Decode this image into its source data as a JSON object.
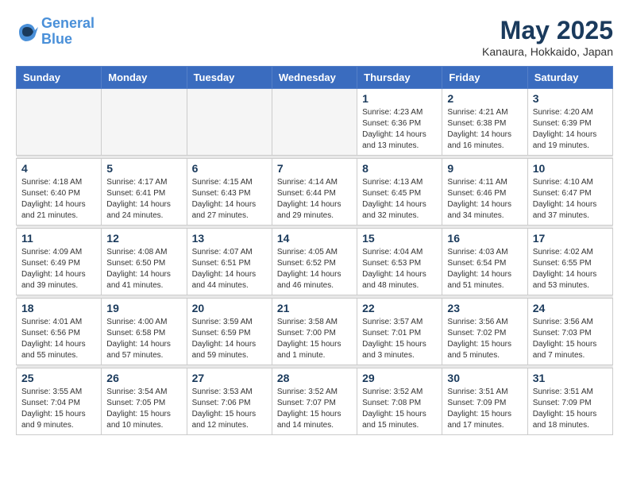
{
  "logo": {
    "line1": "General",
    "line2": "Blue"
  },
  "title": "May 2025",
  "subtitle": "Kanaura, Hokkaido, Japan",
  "days_of_week": [
    "Sunday",
    "Monday",
    "Tuesday",
    "Wednesday",
    "Thursday",
    "Friday",
    "Saturday"
  ],
  "weeks": [
    [
      {
        "day": "",
        "info": ""
      },
      {
        "day": "",
        "info": ""
      },
      {
        "day": "",
        "info": ""
      },
      {
        "day": "",
        "info": ""
      },
      {
        "day": "1",
        "info": "Sunrise: 4:23 AM\nSunset: 6:36 PM\nDaylight: 14 hours\nand 13 minutes."
      },
      {
        "day": "2",
        "info": "Sunrise: 4:21 AM\nSunset: 6:38 PM\nDaylight: 14 hours\nand 16 minutes."
      },
      {
        "day": "3",
        "info": "Sunrise: 4:20 AM\nSunset: 6:39 PM\nDaylight: 14 hours\nand 19 minutes."
      }
    ],
    [
      {
        "day": "4",
        "info": "Sunrise: 4:18 AM\nSunset: 6:40 PM\nDaylight: 14 hours\nand 21 minutes."
      },
      {
        "day": "5",
        "info": "Sunrise: 4:17 AM\nSunset: 6:41 PM\nDaylight: 14 hours\nand 24 minutes."
      },
      {
        "day": "6",
        "info": "Sunrise: 4:15 AM\nSunset: 6:43 PM\nDaylight: 14 hours\nand 27 minutes."
      },
      {
        "day": "7",
        "info": "Sunrise: 4:14 AM\nSunset: 6:44 PM\nDaylight: 14 hours\nand 29 minutes."
      },
      {
        "day": "8",
        "info": "Sunrise: 4:13 AM\nSunset: 6:45 PM\nDaylight: 14 hours\nand 32 minutes."
      },
      {
        "day": "9",
        "info": "Sunrise: 4:11 AM\nSunset: 6:46 PM\nDaylight: 14 hours\nand 34 minutes."
      },
      {
        "day": "10",
        "info": "Sunrise: 4:10 AM\nSunset: 6:47 PM\nDaylight: 14 hours\nand 37 minutes."
      }
    ],
    [
      {
        "day": "11",
        "info": "Sunrise: 4:09 AM\nSunset: 6:49 PM\nDaylight: 14 hours\nand 39 minutes."
      },
      {
        "day": "12",
        "info": "Sunrise: 4:08 AM\nSunset: 6:50 PM\nDaylight: 14 hours\nand 41 minutes."
      },
      {
        "day": "13",
        "info": "Sunrise: 4:07 AM\nSunset: 6:51 PM\nDaylight: 14 hours\nand 44 minutes."
      },
      {
        "day": "14",
        "info": "Sunrise: 4:05 AM\nSunset: 6:52 PM\nDaylight: 14 hours\nand 46 minutes."
      },
      {
        "day": "15",
        "info": "Sunrise: 4:04 AM\nSunset: 6:53 PM\nDaylight: 14 hours\nand 48 minutes."
      },
      {
        "day": "16",
        "info": "Sunrise: 4:03 AM\nSunset: 6:54 PM\nDaylight: 14 hours\nand 51 minutes."
      },
      {
        "day": "17",
        "info": "Sunrise: 4:02 AM\nSunset: 6:55 PM\nDaylight: 14 hours\nand 53 minutes."
      }
    ],
    [
      {
        "day": "18",
        "info": "Sunrise: 4:01 AM\nSunset: 6:56 PM\nDaylight: 14 hours\nand 55 minutes."
      },
      {
        "day": "19",
        "info": "Sunrise: 4:00 AM\nSunset: 6:58 PM\nDaylight: 14 hours\nand 57 minutes."
      },
      {
        "day": "20",
        "info": "Sunrise: 3:59 AM\nSunset: 6:59 PM\nDaylight: 14 hours\nand 59 minutes."
      },
      {
        "day": "21",
        "info": "Sunrise: 3:58 AM\nSunset: 7:00 PM\nDaylight: 15 hours\nand 1 minute."
      },
      {
        "day": "22",
        "info": "Sunrise: 3:57 AM\nSunset: 7:01 PM\nDaylight: 15 hours\nand 3 minutes."
      },
      {
        "day": "23",
        "info": "Sunrise: 3:56 AM\nSunset: 7:02 PM\nDaylight: 15 hours\nand 5 minutes."
      },
      {
        "day": "24",
        "info": "Sunrise: 3:56 AM\nSunset: 7:03 PM\nDaylight: 15 hours\nand 7 minutes."
      }
    ],
    [
      {
        "day": "25",
        "info": "Sunrise: 3:55 AM\nSunset: 7:04 PM\nDaylight: 15 hours\nand 9 minutes."
      },
      {
        "day": "26",
        "info": "Sunrise: 3:54 AM\nSunset: 7:05 PM\nDaylight: 15 hours\nand 10 minutes."
      },
      {
        "day": "27",
        "info": "Sunrise: 3:53 AM\nSunset: 7:06 PM\nDaylight: 15 hours\nand 12 minutes."
      },
      {
        "day": "28",
        "info": "Sunrise: 3:52 AM\nSunset: 7:07 PM\nDaylight: 15 hours\nand 14 minutes."
      },
      {
        "day": "29",
        "info": "Sunrise: 3:52 AM\nSunset: 7:08 PM\nDaylight: 15 hours\nand 15 minutes."
      },
      {
        "day": "30",
        "info": "Sunrise: 3:51 AM\nSunset: 7:09 PM\nDaylight: 15 hours\nand 17 minutes."
      },
      {
        "day": "31",
        "info": "Sunrise: 3:51 AM\nSunset: 7:09 PM\nDaylight: 15 hours\nand 18 minutes."
      }
    ]
  ]
}
